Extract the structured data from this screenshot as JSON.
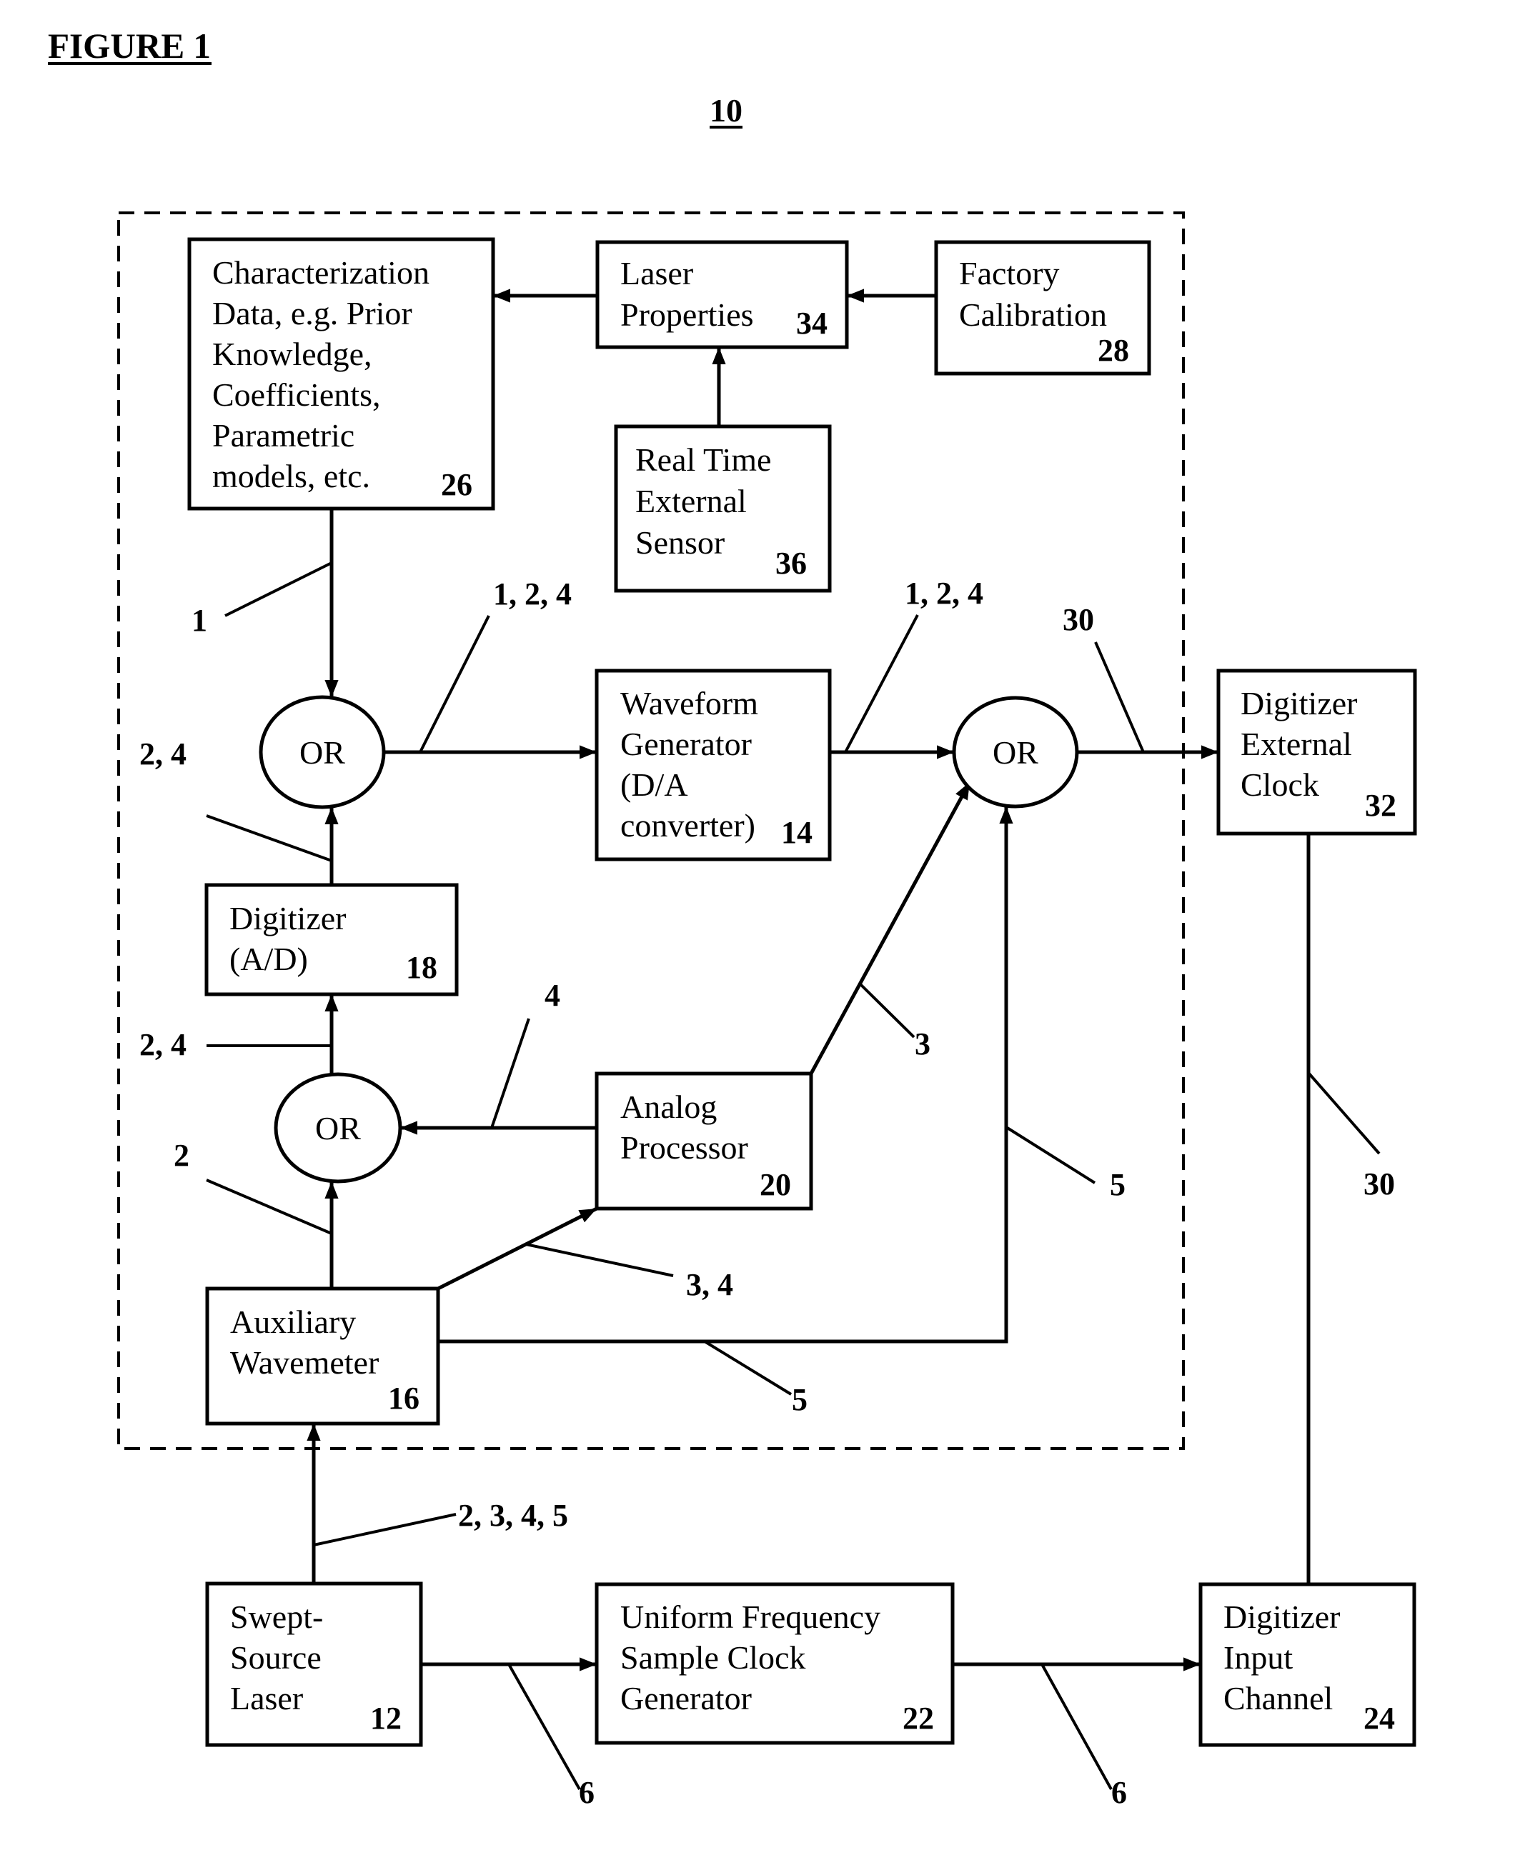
{
  "figure": {
    "title": "FIGURE 1",
    "system_ref": "10"
  },
  "blocks": {
    "characterization": {
      "lines": [
        "Characterization",
        "Data, e.g. Prior",
        "Knowledge,",
        "Coefficients,",
        "Parametric",
        "models, etc."
      ],
      "ref": "26"
    },
    "laser_properties": {
      "lines": [
        "Laser",
        "Properties"
      ],
      "ref": "34"
    },
    "factory_calibration": {
      "lines": [
        "Factory",
        "Calibration"
      ],
      "ref": "28"
    },
    "real_time_sensor": {
      "lines": [
        "Real Time",
        "External",
        "Sensor"
      ],
      "ref": "36"
    },
    "waveform_generator": {
      "lines": [
        "Waveform",
        "Generator",
        "(D/A",
        "converter)"
      ],
      "ref": "14"
    },
    "digitizer_external_clock": {
      "lines": [
        "Digitizer",
        "External",
        "Clock"
      ],
      "ref": "32"
    },
    "digitizer_ad": {
      "lines": [
        "Digitizer",
        "(A/D)"
      ],
      "ref": "18"
    },
    "analog_processor": {
      "lines": [
        "Analog",
        "Processor"
      ],
      "ref": "20"
    },
    "auxiliary_wavemeter": {
      "lines": [
        "Auxiliary",
        "Wavemeter"
      ],
      "ref": "16"
    },
    "swept_source_laser": {
      "lines": [
        "Swept-",
        "Source",
        "Laser"
      ],
      "ref": "12"
    },
    "uniform_clock_generator": {
      "lines": [
        "Uniform Frequency",
        "Sample Clock",
        "Generator"
      ],
      "ref": "22"
    },
    "digitizer_input_channel": {
      "lines": [
        "Digitizer",
        "Input",
        "Channel"
      ],
      "ref": "24"
    }
  },
  "gates": {
    "or_top_left": "OR",
    "or_top_right": "OR",
    "or_lower_left": "OR"
  },
  "path_labels": {
    "char_to_or": "1",
    "or_to_waveform": "1, 2, 4",
    "digitizer_to_or": "2, 4",
    "waveform_to_or": "1, 2, 4",
    "or_to_clock": "30",
    "analog_to_or_lower": "4",
    "or_lower_to_digitizer": "2, 4",
    "analog_to_or_top": "3",
    "wavemeter_to_or_lower": "2",
    "vertical_to_or_top": "5",
    "wavemeter_to_analog": "3, 4",
    "wavemeter_to_or_path": "5",
    "clock_to_input": "30",
    "laser_to_wavemeter": "2, 3, 4, 5",
    "laser_to_uniform": "6",
    "uniform_to_input": "6"
  }
}
